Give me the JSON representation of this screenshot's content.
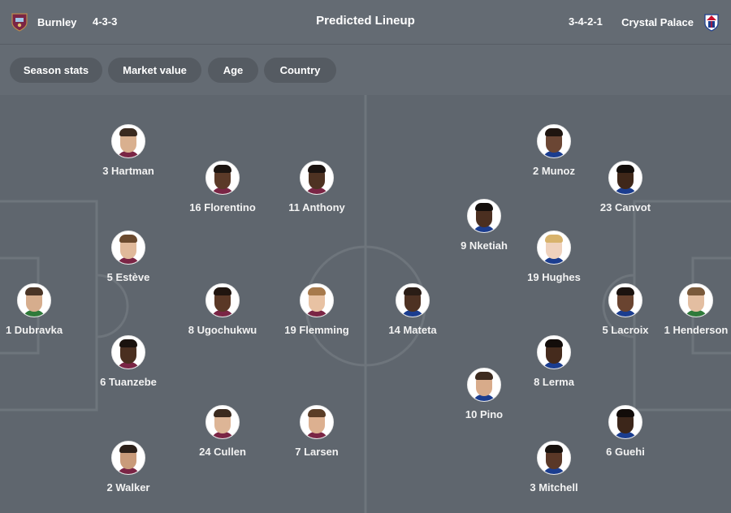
{
  "header": {
    "title": "Predicted Lineup",
    "home": {
      "name": "Burnley",
      "formation": "4-3-3",
      "crest_color": "#7a2545"
    },
    "away": {
      "name": "Crystal Palace",
      "formation": "3-4-2-1",
      "crest_color": "#1b3d8f"
    }
  },
  "filters": [
    "Season stats",
    "Market value",
    "Age",
    "Country"
  ],
  "home_players": [
    {
      "label": "3 Hartman"
    },
    {
      "label": "16 Florentino"
    },
    {
      "label": "11 Anthony"
    },
    {
      "label": "5 Estève"
    },
    {
      "label": "1 Dubravka"
    },
    {
      "label": "8 Ugochukwu"
    },
    {
      "label": "19 Flemming"
    },
    {
      "label": "6 Tuanzebe"
    },
    {
      "label": "24 Cullen"
    },
    {
      "label": "7 Larsen"
    },
    {
      "label": "2 Walker"
    }
  ],
  "away_players": [
    {
      "label": "2 Munoz"
    },
    {
      "label": "23 Canvot"
    },
    {
      "label": "9 Nketiah"
    },
    {
      "label": "19 Hughes"
    },
    {
      "label": "14 Mateta"
    },
    {
      "label": "5 Lacroix"
    },
    {
      "label": "1 Henderson"
    },
    {
      "label": "8 Lerma"
    },
    {
      "label": "10 Pino"
    },
    {
      "label": "6 Guehi"
    },
    {
      "label": "3 Mitchell"
    }
  ]
}
